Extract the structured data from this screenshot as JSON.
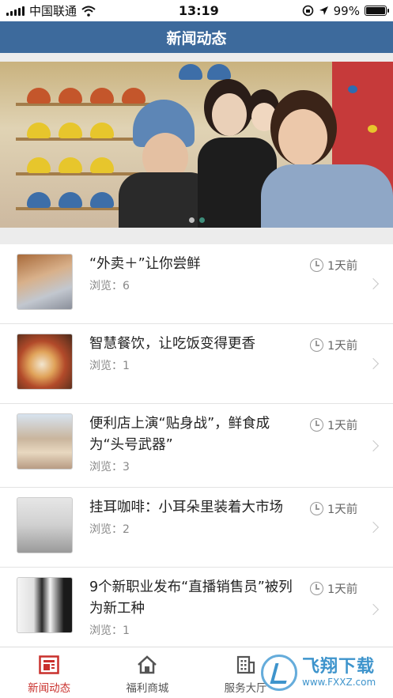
{
  "status_bar": {
    "carrier": "中国联通",
    "time": "13:19",
    "battery": "99%",
    "battery_level": 0.99
  },
  "header": {
    "title": "新闻动态"
  },
  "banner": {
    "slide_count": 2,
    "active_index": 1
  },
  "news": [
    {
      "title": "“外卖＋”让你尝鲜",
      "views_label": "浏览：6",
      "time": "1天前"
    },
    {
      "title": "智慧餐饮，让吃饭变得更香",
      "views_label": "浏览：1",
      "time": "1天前"
    },
    {
      "title": "便利店上演“贴身战”，鲜食成为“头号武器”",
      "views_label": "浏览：3",
      "time": "1天前"
    },
    {
      "title": "挂耳咖啡：小耳朵里装着大市场",
      "views_label": "浏览：2",
      "time": "1天前"
    },
    {
      "title": "9个新职业发布“直播销售员”被列为新工种",
      "views_label": "浏览：1",
      "time": "1天前"
    }
  ],
  "tabs": [
    {
      "label": "新闻动态",
      "icon": "news-icon",
      "active": true
    },
    {
      "label": "福利商城",
      "icon": "home-icon",
      "active": false
    },
    {
      "label": "服务大厅",
      "icon": "building-icon",
      "active": false
    }
  ],
  "watermark": {
    "text_cn": "飞翔下载",
    "text_en": "www.FXXZ.com"
  },
  "colors": {
    "header_bg": "#3d6a9c",
    "active_tab": "#c9302c",
    "dot_active": "#3d8d7a"
  }
}
